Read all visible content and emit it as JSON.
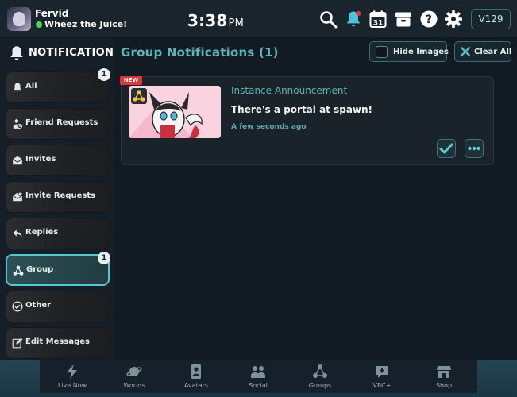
{
  "topbar": {
    "user_name": "Fervid",
    "user_status": "Wheez the Juice!",
    "time": "3:38",
    "ampm": "PM",
    "calendar_day": "31",
    "credits": "V129",
    "icons": [
      "search-icon",
      "bell-icon",
      "calendar-icon",
      "inventory-icon",
      "help-icon",
      "gear-icon"
    ]
  },
  "sidebar": {
    "title": "NOTIFICATIONS",
    "items": [
      {
        "label": "All",
        "badge": "1"
      },
      {
        "label": "Friend Requests"
      },
      {
        "label": "Invites"
      },
      {
        "label": "Invite Requests"
      },
      {
        "label": "Replies"
      },
      {
        "label": "Group",
        "badge": "1",
        "active": true
      },
      {
        "label": "Other"
      },
      {
        "label": "Edit Messages"
      }
    ]
  },
  "main": {
    "title": "Group Notifications (1)",
    "hide_images_label": "Hide Images",
    "clear_all_label": "Clear All",
    "notification": {
      "tag": "NEW",
      "type": "Instance Announcement",
      "message": "There's a portal at spawn!",
      "time": "A few seconds ago"
    }
  },
  "dock": {
    "items": [
      {
        "label": "Live Now"
      },
      {
        "label": "Worlds"
      },
      {
        "label": "Avatars"
      },
      {
        "label": "Social"
      },
      {
        "label": "Groups"
      },
      {
        "label": "VRC+"
      },
      {
        "label": "Shop"
      }
    ]
  },
  "colors": {
    "accent": "#5fb4b9",
    "active_border": "#56c7cf",
    "bell": "#4cc3d6",
    "new_tag": "#e1353b",
    "status_online": "#48d657"
  }
}
